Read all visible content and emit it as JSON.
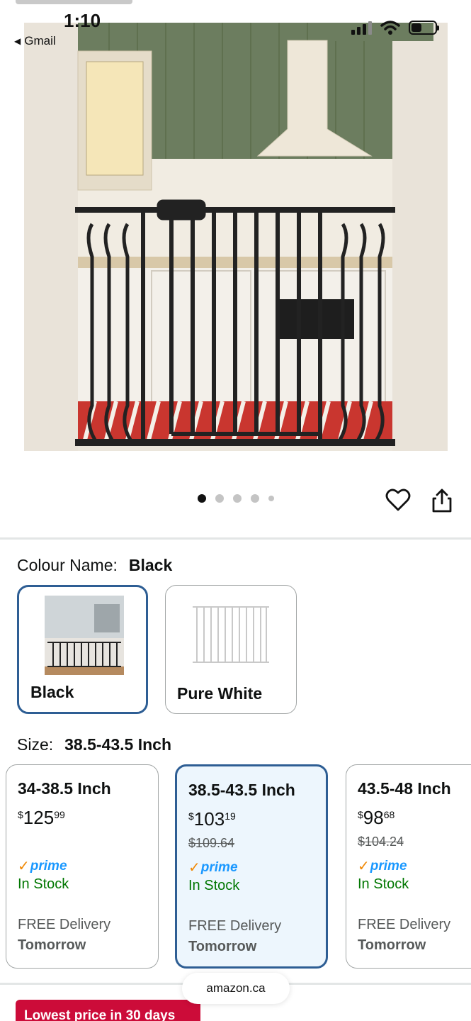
{
  "status_bar": {
    "time": "1:10",
    "back_app": "Gmail"
  },
  "gallery": {
    "image_count": 5,
    "active_index": 0,
    "icons": [
      "heart-icon",
      "share-icon"
    ]
  },
  "colour": {
    "label": "Colour Name:",
    "selected": "Black",
    "options": [
      {
        "name": "Black",
        "selected": true
      },
      {
        "name": "Pure White",
        "selected": false
      }
    ]
  },
  "size": {
    "label": "Size:",
    "selected": "38.5-43.5 Inch",
    "options": [
      {
        "name": "34-38.5 Inch",
        "price_symbol": "$",
        "price_whole": "125",
        "price_cents": "99",
        "list_price": "",
        "prime": "prime",
        "stock": "In Stock",
        "delivery": "FREE Delivery",
        "delivery_when": "Tomorrow",
        "selected": false
      },
      {
        "name": "38.5-43.5 Inch",
        "price_symbol": "$",
        "price_whole": "103",
        "price_cents": "19",
        "list_price": "$109.64",
        "prime": "prime",
        "stock": "In Stock",
        "delivery": "FREE Delivery",
        "delivery_when": "Tomorrow",
        "selected": true
      },
      {
        "name": "43.5-48 Inch",
        "price_symbol": "$",
        "price_whole": "98",
        "price_cents": "68",
        "list_price": "$104.24",
        "prime": "prime",
        "stock": "In Stock",
        "delivery": "FREE Delivery",
        "delivery_when": "Tomorrow",
        "selected": false
      }
    ]
  },
  "browser": {
    "domain": "amazon.ca"
  },
  "deal": {
    "badge": "Lowest price in 30 days"
  },
  "colors": {
    "selected_border": "#2e5e94",
    "selected_bg": "#edf6fd",
    "in_stock": "#007600",
    "prime_blue": "#1a98ff",
    "prime_check": "#f08804",
    "deal_red": "#cc0c39"
  }
}
